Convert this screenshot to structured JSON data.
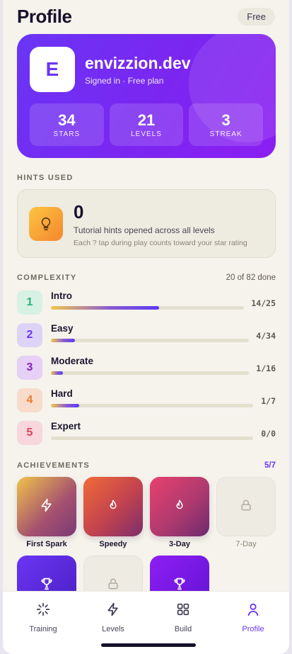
{
  "header": {
    "title": "Profile",
    "plan_badge": "Free"
  },
  "profile": {
    "avatar_letter": "E",
    "username": "envizzion.dev",
    "status": "Signed in · Free plan",
    "stats": [
      {
        "value": "34",
        "label": "STARS"
      },
      {
        "value": "21",
        "label": "LEVELS"
      },
      {
        "value": "3",
        "label": "STREAK"
      }
    ]
  },
  "hints": {
    "section_title": "HINTS USED",
    "count": "0",
    "description": "Tutorial hints opened across all levels",
    "subtext": "Each ? tap during play counts toward your star rating",
    "icon": "lightbulb-icon"
  },
  "complexity": {
    "section_title": "COMPLEXITY",
    "summary": "20 of 82 done",
    "levels": [
      {
        "number": "1",
        "name": "Intro",
        "count": "14/25",
        "progress": 0.56,
        "badge_bg": "#d7f1e4",
        "badge_fg": "#2bb07a"
      },
      {
        "number": "2",
        "name": "Easy",
        "count": "4/34",
        "progress": 0.12,
        "badge_bg": "#ddd3f6",
        "badge_fg": "#6a35f5"
      },
      {
        "number": "3",
        "name": "Moderate",
        "count": "1/16",
        "progress": 0.06,
        "badge_bg": "#e6d0f5",
        "badge_fg": "#8b1ec0"
      },
      {
        "number": "4",
        "name": "Hard",
        "count": "1/7",
        "progress": 0.14,
        "badge_bg": "#f8dccb",
        "badge_fg": "#ee7a2f"
      },
      {
        "number": "5",
        "name": "Expert",
        "count": "0/0",
        "progress": 0,
        "badge_bg": "#f7d6dc",
        "badge_fg": "#e0405f"
      }
    ]
  },
  "achievements": {
    "section_title": "ACHIEVEMENTS",
    "count": "5/7",
    "items": [
      {
        "label": "First Spark",
        "icon": "bolt-icon",
        "unlocked": true,
        "bg": "linear-gradient(135deg,#efc44a,#a4506f 60%,#7c3a76)"
      },
      {
        "label": "Speedy",
        "icon": "flame-icon",
        "unlocked": true,
        "bg": "linear-gradient(135deg,#f16a37,#c2434f 55%,#7b2d6c)"
      },
      {
        "label": "3-Day",
        "icon": "flame-icon",
        "unlocked": true,
        "bg": "linear-gradient(135deg,#e8416e,#b03a6f 55%,#6c2a6f)"
      },
      {
        "label": "7-Day",
        "icon": "lock-icon",
        "unlocked": false,
        "bg": "#eeebe3"
      },
      {
        "label": "",
        "icon": "trophy-icon",
        "unlocked": true,
        "bg": "linear-gradient(135deg,#6a35f5,#4a1fc0)"
      },
      {
        "label": "",
        "icon": "lock-icon",
        "unlocked": false,
        "bg": "#eeebe3"
      },
      {
        "label": "",
        "icon": "trophy-icon",
        "unlocked": true,
        "bg": "linear-gradient(135deg,#8e1ef5,#6013d1)"
      }
    ]
  },
  "tabbar": {
    "tabs": [
      {
        "label": "Training",
        "icon": "sparkle-icon",
        "active": false
      },
      {
        "label": "Levels",
        "icon": "bolt-icon",
        "active": false
      },
      {
        "label": "Build",
        "icon": "grid-icon",
        "active": false
      },
      {
        "label": "Profile",
        "icon": "person-icon",
        "active": true
      }
    ],
    "accent": "#6a35f5"
  }
}
